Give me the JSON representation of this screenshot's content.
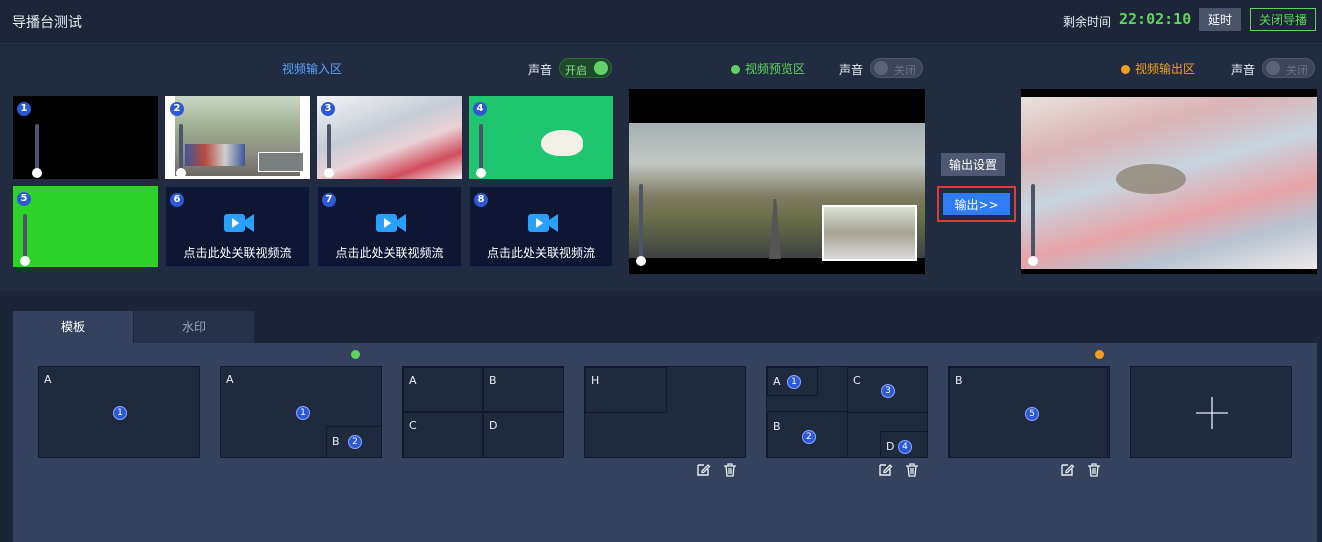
{
  "header": {
    "title": "导播台测试",
    "remaining_label": "剩余时间",
    "remaining_time": "22:02:10",
    "delay_button": "延时",
    "close_button": "关闭导播"
  },
  "input_area": {
    "label": "视频输入区",
    "sound_label": "声音",
    "sound_toggle": "开启",
    "cells": [
      {
        "num": "1"
      },
      {
        "num": "2"
      },
      {
        "num": "3"
      },
      {
        "num": "4"
      },
      {
        "num": "5"
      },
      {
        "num": "6",
        "text": "点击此处关联视频流"
      },
      {
        "num": "7",
        "text": "点击此处关联视频流"
      },
      {
        "num": "8",
        "text": "点击此处关联视频流"
      }
    ]
  },
  "preview_area": {
    "label": "视频预览区",
    "sound_label": "声音",
    "sound_toggle": "关闭",
    "dot_color": "#5fd35f"
  },
  "output_area": {
    "label": "视频输出区",
    "sound_label": "声音",
    "sound_toggle": "关闭",
    "dot_color": "#f0a020"
  },
  "controls": {
    "output_settings": "输出设置",
    "output_button": "输出>>"
  },
  "tabs": [
    "模板",
    "水印"
  ],
  "templates": [
    {
      "labels": [
        "A"
      ],
      "nums": [
        "1"
      ]
    },
    {
      "labels": [
        "A",
        "B"
      ],
      "nums": [
        "1",
        "2"
      ],
      "status": "preview"
    },
    {
      "labels": [
        "A",
        "B",
        "C",
        "D"
      ]
    },
    {
      "labels": [
        "H"
      ]
    },
    {
      "labels": [
        "A",
        "C",
        "B",
        "D"
      ],
      "nums": [
        "1",
        "3",
        "2",
        "4"
      ]
    },
    {
      "labels": [
        "B"
      ],
      "nums": [
        "5"
      ],
      "status": "output"
    }
  ],
  "colors": {
    "accent_green": "#5fd35f",
    "accent_orange": "#f0a020",
    "accent_blue": "#2f7cf5",
    "highlight_red": "#e23b3b"
  }
}
